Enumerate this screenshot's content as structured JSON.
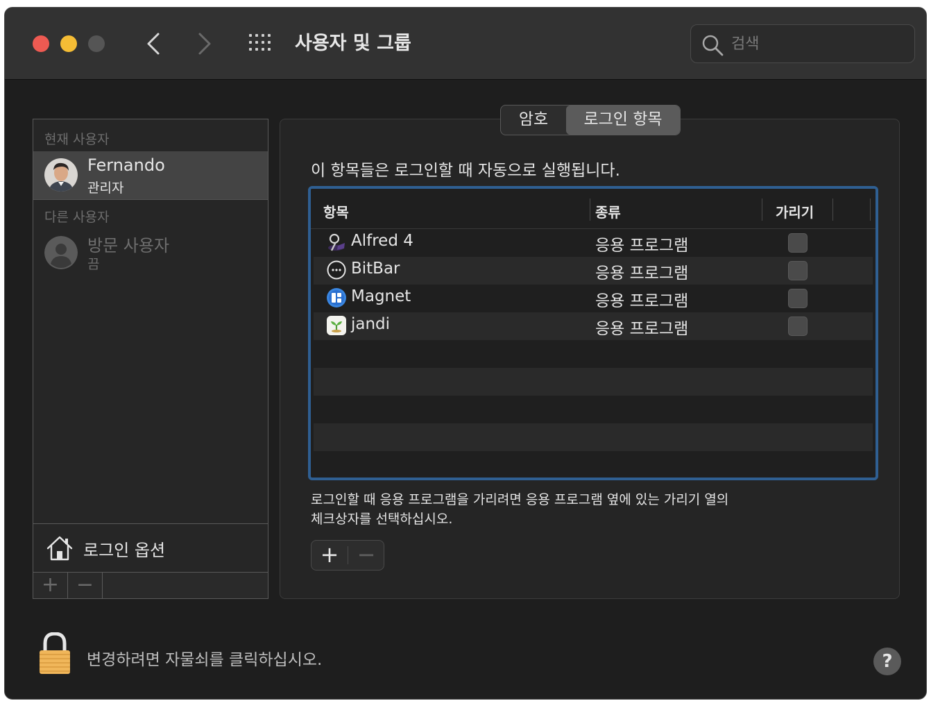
{
  "window": {
    "title": "사용자 및 그룹",
    "search_placeholder": "검색"
  },
  "sidebar": {
    "current_users_label": "현재 사용자",
    "current_user": {
      "name": "Fernando",
      "role": "관리자"
    },
    "other_users_label": "다른 사용자",
    "other_user": {
      "name": "방문 사용자",
      "status": "끔"
    },
    "login_options_label": "로그인 옵션",
    "add_label": "+",
    "remove_label": "−"
  },
  "tabs": [
    {
      "label": "암호",
      "selected": false
    },
    {
      "label": "로그인 항목",
      "selected": true
    }
  ],
  "panel": {
    "description": "이 항목들은 로그인할 때 자동으로 실행됩니다.",
    "columns": [
      "항목",
      "종류",
      "가리기"
    ],
    "rows": [
      {
        "name": "Alfred 4",
        "type": "응용 프로그램",
        "hide": false,
        "icon": "alfred-icon"
      },
      {
        "name": "BitBar",
        "type": "응용 프로그램",
        "hide": false,
        "icon": "bitbar-icon"
      },
      {
        "name": "Magnet",
        "type": "응용 프로그램",
        "hide": false,
        "icon": "magnet-icon"
      },
      {
        "name": "jandi",
        "type": "응용 프로그램",
        "hide": false,
        "icon": "jandi-icon"
      }
    ],
    "hint_line1": "로그인할 때 응용 프로그램을 가리려면 응용 프로그램 옆에 있는 가리기 열의",
    "hint_line2": "체크상자를 선택하십시오.",
    "add_label": "+",
    "remove_label": "−"
  },
  "footer": {
    "lock_text": "변경하려면 자물쇠를 클릭하십시오.",
    "help_label": "?"
  },
  "colors": {
    "window_bg": "#1e1e1e",
    "accent_focus": "#2f5f92",
    "close": "#ee5a52",
    "minimize": "#f5bd35"
  }
}
